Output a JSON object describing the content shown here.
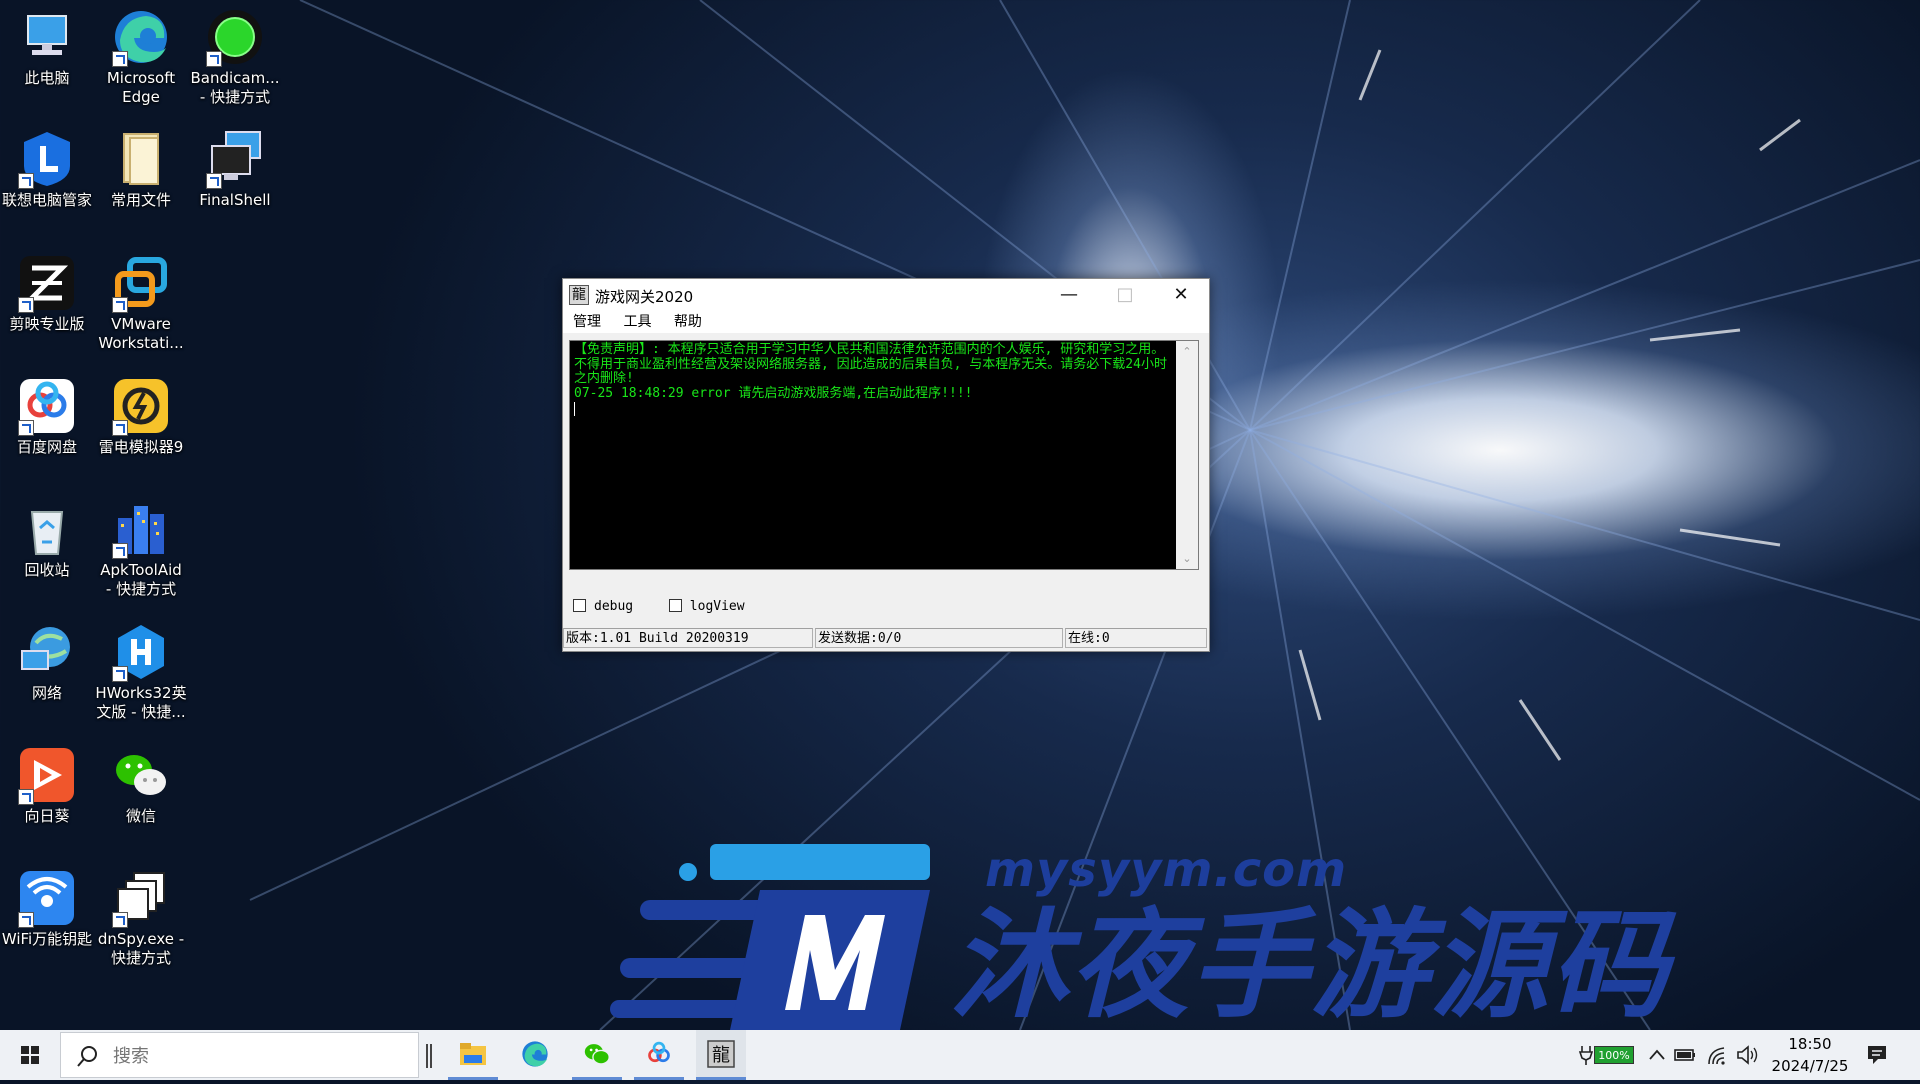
{
  "desktop": {
    "icons": [
      {
        "label": "此电脑"
      },
      {
        "label": "Microsoft\nEdge"
      },
      {
        "label": "Bandicam...\n- 快捷方式"
      },
      {
        "label": "联想电脑管家"
      },
      {
        "label": "常用文件"
      },
      {
        "label": "FinalShell"
      },
      {
        "label": "剪映专业版"
      },
      {
        "label": "VMware\nWorkstati..."
      },
      {
        "label": "百度网盘"
      },
      {
        "label": "雷电模拟器9"
      },
      {
        "label": "回收站"
      },
      {
        "label": "ApkToolAid\n- 快捷方式"
      },
      {
        "label": "网络"
      },
      {
        "label": "HWorks32英\n文版 - 快捷..."
      },
      {
        "label": "向日葵"
      },
      {
        "label": "微信"
      },
      {
        "label": "WiFi万能钥匙"
      },
      {
        "label": "dnSpy.exe -\n快捷方式"
      }
    ]
  },
  "window": {
    "icon_char": "龍",
    "title": "游戏网关2020",
    "menu": [
      "管理",
      "工具",
      "帮助"
    ],
    "console_lines": [
      "【免责声明】: 本程序只适合用于学习中华人民共和国法律允许范围内的个人娱乐, 研究和学习之用。不得用于商业盈利性经营及架设网络服务器, 因此造成的后果自负, 与本程序无关。请务必下载24小时之内删除!",
      "07-25 18:48:29 error 请先启动游戏服务端,在启动此程序!!!!"
    ],
    "checkboxes": [
      {
        "label": "debug"
      },
      {
        "label": "logView"
      }
    ],
    "status": {
      "version": "版本:1.01 Build 20200319",
      "send": "发送数据:0/0",
      "online": "在线:0"
    }
  },
  "watermark": {
    "url": "mysyym.com",
    "title": "沐夜手游源码"
  },
  "taskbar": {
    "search_placeholder": "搜索",
    "battery": "100%",
    "time": "18:50",
    "date": "2024/7/25",
    "apps": [
      "file-explorer",
      "edge",
      "wechat",
      "baidu-netdisk",
      "game-gateway"
    ]
  },
  "colors": {
    "console_text": "#19e619",
    "watermark": "#1e3f9e",
    "taskbar": "#eef1f5"
  }
}
